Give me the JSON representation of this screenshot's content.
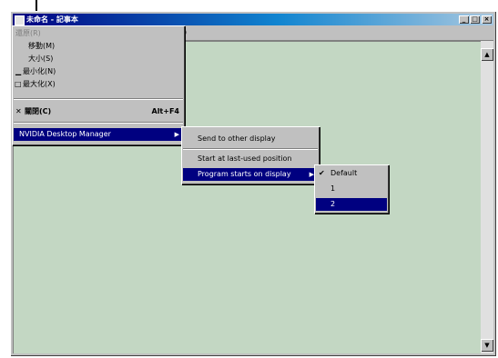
{
  "window": {
    "title": "未命名 - 記事本",
    "minimize": "_",
    "maximize": "□",
    "close": "×"
  },
  "menubar_fragment": ")",
  "system_menu": {
    "items": [
      {
        "label": "還原(R)",
        "glyph": "",
        "disabled": true
      },
      {
        "label": "移動(M)",
        "glyph": ""
      },
      {
        "label": "大小(S)",
        "glyph": ""
      },
      {
        "label": "最小化(N)",
        "glyph": "▁"
      },
      {
        "label": "最大化(X)",
        "glyph": "□"
      },
      {
        "label": "關閉(C)",
        "glyph": "✕",
        "accelerator": "Alt+F4"
      },
      {
        "label": "NVIDIA Desktop Manager",
        "selected": true
      }
    ]
  },
  "submenu1": {
    "items": [
      {
        "label": "Send to other display"
      },
      {
        "label": "Start at last-used position"
      },
      {
        "label": "Program starts on display",
        "selected": true
      }
    ]
  },
  "submenu2": {
    "items": [
      {
        "label": "Default",
        "checked": true,
        "check": "✔"
      },
      {
        "label": "1"
      },
      {
        "label": "2",
        "selected": true
      }
    ]
  },
  "scroll": {
    "up": "▲",
    "down": "▼"
  }
}
